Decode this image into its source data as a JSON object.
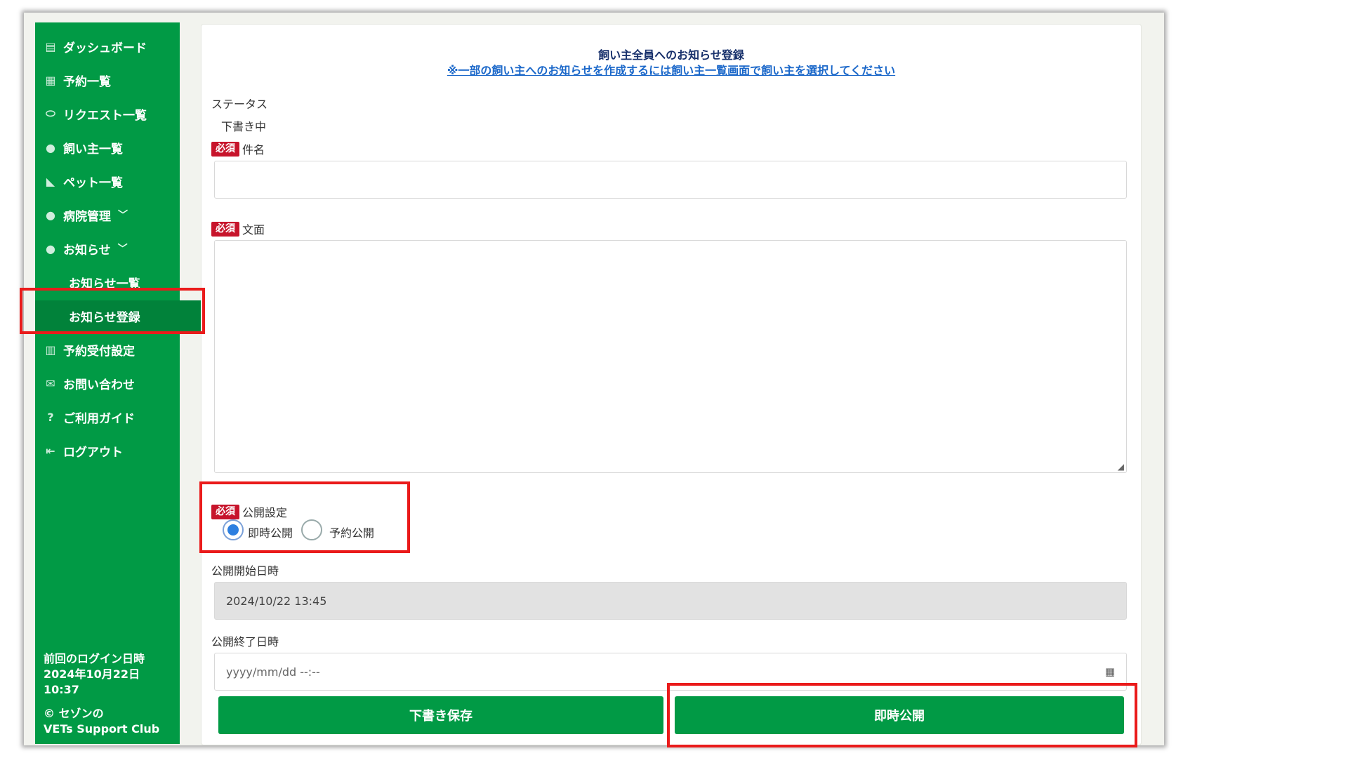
{
  "sidebar": {
    "items": [
      {
        "label": "ダッシュボード",
        "icon": "dashboard-icon",
        "glyph": "▤"
      },
      {
        "label": "予約一覧",
        "icon": "calendar-icon",
        "glyph": "▦"
      },
      {
        "label": "リクエスト一覧",
        "icon": "pill-icon",
        "glyph": "⬭"
      },
      {
        "label": "飼い主一覧",
        "icon": "person-icon",
        "glyph": "●"
      },
      {
        "label": "ペット一覧",
        "icon": "pet-icon",
        "glyph": "◣"
      },
      {
        "label": "病院管理",
        "icon": "person-icon",
        "glyph": "●"
      },
      {
        "label": "お知らせ",
        "icon": "person-icon",
        "glyph": "●"
      }
    ],
    "sub_items": [
      {
        "label": "お知らせ一覧"
      },
      {
        "label": "お知らせ登録"
      }
    ],
    "items_after": [
      {
        "label": "予約受付設定",
        "icon": "clipboard-icon",
        "glyph": "▥"
      },
      {
        "label": "お問い合わせ",
        "icon": "mail-icon",
        "glyph": "✉"
      },
      {
        "label": "ご利用ガイド",
        "icon": "help-icon",
        "glyph": "?"
      },
      {
        "label": "ログアウト",
        "icon": "logout-icon",
        "glyph": "⇤"
      }
    ],
    "chevron": "﹀",
    "last_login_label": "前回のログイン日時",
    "last_login_date": "2024年10月22日",
    "last_login_time": "10:37",
    "copyright_line1": "© セゾンの",
    "copyright_line2": "VETs Support Club"
  },
  "main": {
    "title": "飼い主全員へのお知らせ登録",
    "link": "※一部の飼い主へのお知らせを作成するには飼い主一覧画面で飼い主を選択してください",
    "status_label": "ステータス",
    "status_value": "下書き中",
    "required_badge": "必須",
    "subject_label": "件名",
    "subject_value": "",
    "body_label": "文面",
    "body_value": "",
    "publish_label": "公開設定",
    "publish_options": [
      {
        "label": "即時公開",
        "checked": true
      },
      {
        "label": "予約公開",
        "checked": false
      }
    ],
    "start_label": "公開開始日時",
    "start_value": "2024/10/22 13:45",
    "end_label": "公開終了日時",
    "end_placeholder": "yyyy/mm/dd --:--",
    "save_button": "下書き保存",
    "publish_button": "即時公開"
  },
  "colors": {
    "sidebar": "#019a45",
    "required": "#c7142b",
    "highlight": "#ea1b1b"
  }
}
